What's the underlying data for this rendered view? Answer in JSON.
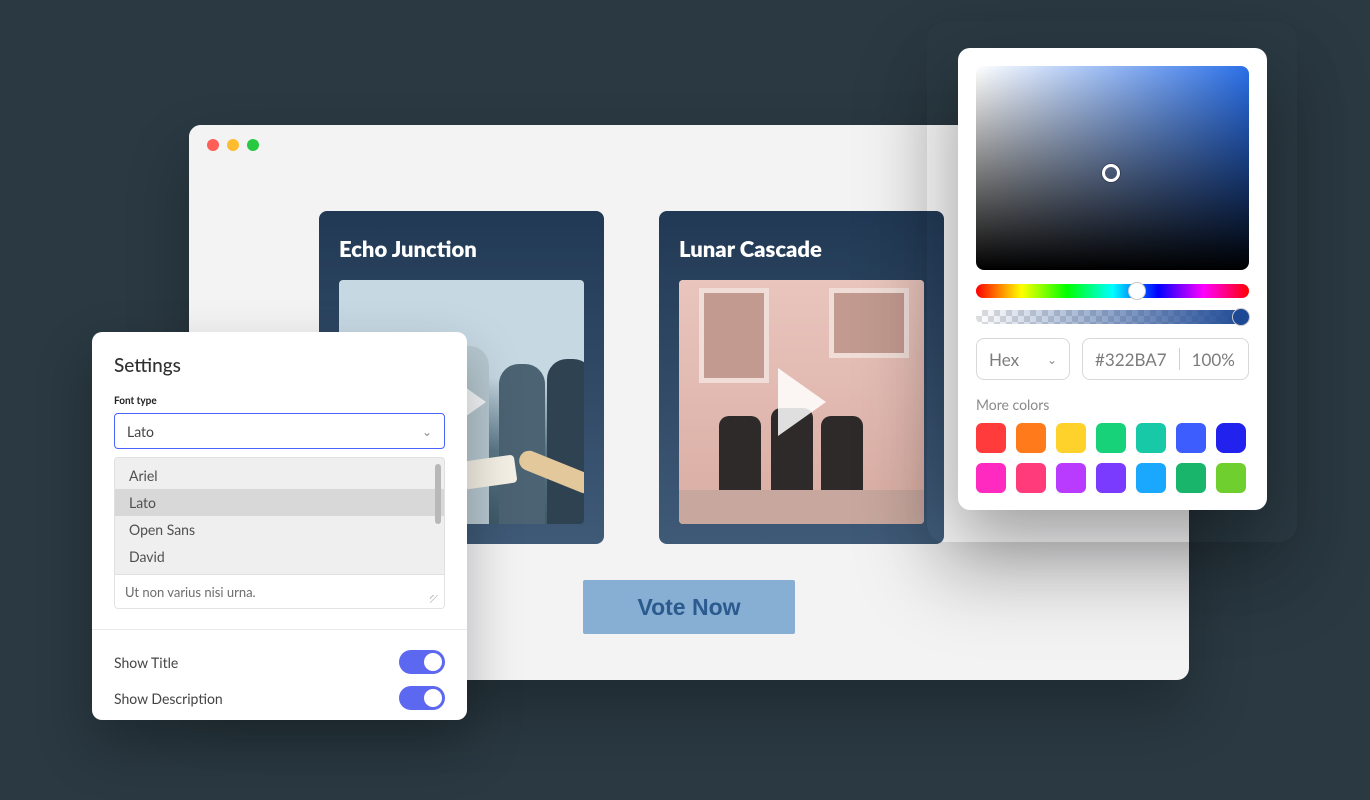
{
  "browser": {
    "cards": [
      {
        "title": "Echo Junction"
      },
      {
        "title": "Lunar Cascade"
      }
    ],
    "cta": "Vote Now"
  },
  "settings": {
    "title": "Settings",
    "font_type_label": "Font type",
    "font_selected": "Lato",
    "font_options": [
      "Ariel",
      "Lato",
      "Open Sans",
      "David"
    ],
    "textarea_value": "Ut non varius nisi urna.",
    "show_title_label": "Show Title",
    "show_description_label": "Show Description",
    "show_title_on": true,
    "show_description_on": true
  },
  "picker": {
    "format": "Hex",
    "hex": "#322BA7",
    "opacity": "100%",
    "more_label": "More colors",
    "swatches": [
      "#ff3b3b",
      "#ff7a1a",
      "#ffd12b",
      "#18d27a",
      "#18c9a8",
      "#3d5dff",
      "#2222ef",
      "#ff2abf",
      "#ff3b7b",
      "#b93bff",
      "#7a3bff",
      "#1aa8ff",
      "#18b56a",
      "#6fcf2e"
    ],
    "selected_swatch_index": 6
  }
}
